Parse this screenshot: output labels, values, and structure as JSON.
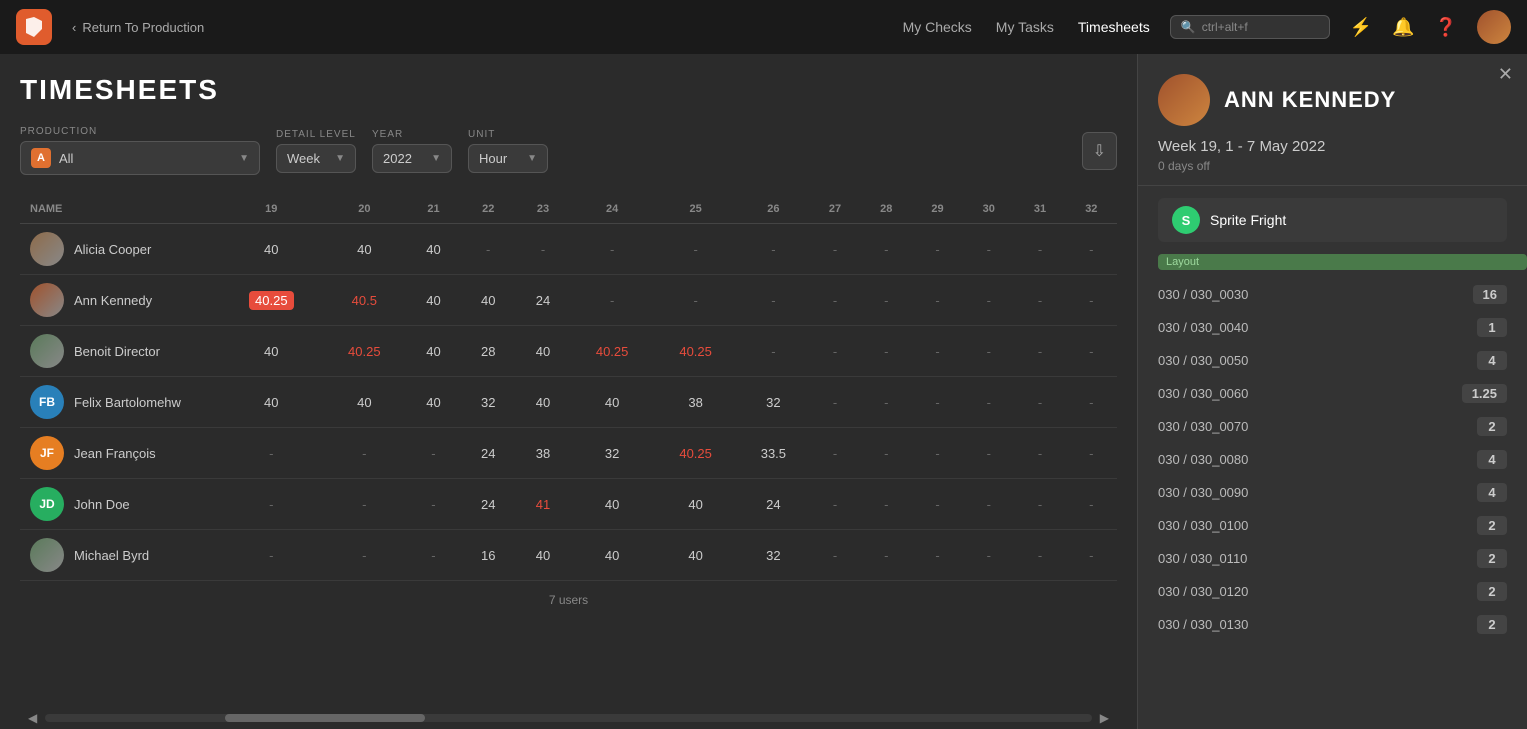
{
  "app": {
    "title": "TIMESHEETS"
  },
  "topnav": {
    "back_label": "Return To Production",
    "nav_links": [
      "My Checks",
      "My Tasks",
      "Timesheets"
    ],
    "active_nav": "Timesheets",
    "search_placeholder": "ctrl+alt+f"
  },
  "filters": {
    "production_label": "PRODUCTION",
    "production_value": "All",
    "detail_label": "DETAIL LEVEL",
    "detail_value": "Week",
    "year_label": "YEAR",
    "year_value": "2022",
    "unit_label": "UNIT",
    "unit_value": "Hour"
  },
  "table": {
    "columns": [
      "NAME",
      "19",
      "20",
      "21",
      "22",
      "23",
      "24",
      "25",
      "26",
      "27",
      "28",
      "29",
      "30",
      "31",
      "32"
    ],
    "users": [
      {
        "name": "Alicia Cooper",
        "avatar_type": "image",
        "cells": [
          "40",
          "40",
          "40",
          "-",
          "-",
          "-",
          "-",
          "-",
          "-",
          "-",
          "-",
          "-",
          "-",
          "-"
        ]
      },
      {
        "name": "Ann Kennedy",
        "avatar_type": "image",
        "cells": [
          "40.25",
          "40.5",
          "40",
          "40",
          "24",
          "-",
          "-",
          "-",
          "-",
          "-",
          "-",
          "-",
          "-",
          "-"
        ],
        "highlight_cells": [
          0
        ],
        "red_cells": [
          1
        ]
      },
      {
        "name": "Benoit Director",
        "avatar_type": "image",
        "cells": [
          "40",
          "40.25",
          "40",
          "28",
          "40",
          "40.25",
          "40.25",
          "-",
          "-",
          "-",
          "-",
          "-",
          "-",
          "-"
        ],
        "red_cells": [
          1,
          5,
          6
        ]
      },
      {
        "name": "Felix Bartolomehw",
        "avatar_type": "initials",
        "initials": "FB",
        "color": "#2980b9",
        "cells": [
          "40",
          "40",
          "40",
          "32",
          "40",
          "40",
          "38",
          "32",
          "-",
          "-",
          "-",
          "-",
          "-",
          "-"
        ]
      },
      {
        "name": "Jean François",
        "avatar_type": "initials",
        "initials": "JF",
        "color": "#e67e22",
        "cells": [
          "-",
          "-",
          "-",
          "24",
          "38",
          "32",
          "40.25",
          "33.5",
          "-",
          "-",
          "-",
          "-",
          "-",
          "-"
        ],
        "red_cells": [
          6
        ]
      },
      {
        "name": "John Doe",
        "avatar_type": "initials",
        "initials": "JD",
        "color": "#27ae60",
        "cells": [
          "-",
          "-",
          "-",
          "24",
          "41",
          "40",
          "40",
          "24",
          "-",
          "-",
          "-",
          "-",
          "-",
          "-"
        ],
        "red_cells": [
          4
        ]
      },
      {
        "name": "Michael Byrd",
        "avatar_type": "image",
        "cells": [
          "-",
          "-",
          "-",
          "16",
          "40",
          "40",
          "40",
          "32",
          "-",
          "-",
          "-",
          "-",
          "-",
          "-"
        ]
      }
    ],
    "footer": "7 users"
  },
  "right_panel": {
    "user_name": "ANN KENNEDY",
    "week_label": "Week 19, 1 - 7 May 2022",
    "days_off": "0 days off",
    "production_name": "Sprite Fright",
    "prod_initial": "S",
    "category_label": "Layout",
    "shots": [
      {
        "name": "030 / 030_0030",
        "value": "16"
      },
      {
        "name": "030 / 030_0040",
        "value": "1"
      },
      {
        "name": "030 / 030_0050",
        "value": "4"
      },
      {
        "name": "030 / 030_0060",
        "value": "1.25"
      },
      {
        "name": "030 / 030_0070",
        "value": "2"
      },
      {
        "name": "030 / 030_0080",
        "value": "4"
      },
      {
        "name": "030 / 030_0090",
        "value": "4"
      },
      {
        "name": "030 / 030_0100",
        "value": "2"
      },
      {
        "name": "030 / 030_0110",
        "value": "2"
      },
      {
        "name": "030 / 030_0120",
        "value": "2"
      },
      {
        "name": "030 / 030_0130",
        "value": "2"
      }
    ]
  }
}
